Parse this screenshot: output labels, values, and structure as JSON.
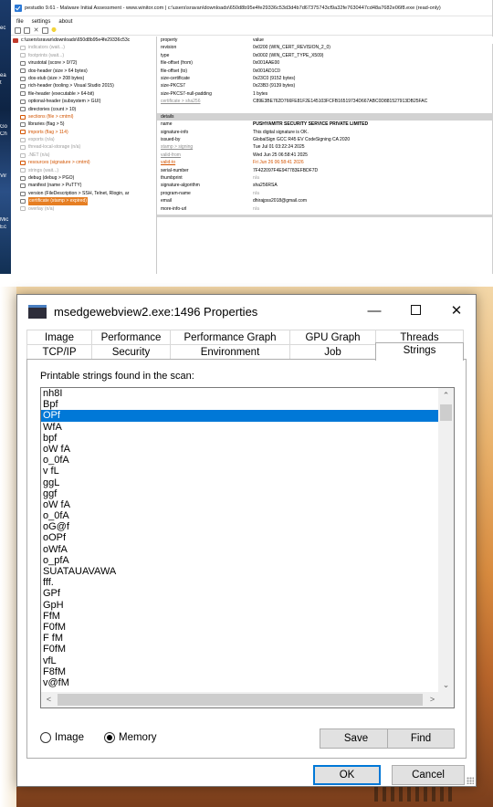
{
  "pestudio": {
    "title": "pestudio 9.61 - Malware Initial Assessment - www.winitor.com | c:\\users\\sravan\\downloads\\650d8b95e4fe29336c53d3d4b7d67375743cf9a32fe7630447cd48a7682e06f8.exe (read-only)",
    "menu": [
      "file",
      "settings",
      "about"
    ],
    "tree": [
      {
        "label": "c:\\users\\sravan\\downloads\\650d8b95e4fe29336c53c",
        "style": "root"
      },
      {
        "label": "indicators (wait...)",
        "style": "dim"
      },
      {
        "label": "footprints (wait...)",
        "style": "dim"
      },
      {
        "label": "virustotal (score > 0/72)",
        "style": "normal"
      },
      {
        "label": "dos-header (size > 64 bytes)",
        "style": "normal"
      },
      {
        "label": "dos-stub (size > 208 bytes)",
        "style": "normal"
      },
      {
        "label": "rich-header (tooling > Visual Studio 2015)",
        "style": "normal"
      },
      {
        "label": "file-header (executable > 64-bit)",
        "style": "normal"
      },
      {
        "label": "optional-header (subsystem > GUI)",
        "style": "normal"
      },
      {
        "label": "directories (count > 10)",
        "style": "normal"
      },
      {
        "label": "sections (file > cmtml)",
        "style": "alert"
      },
      {
        "label": "libraries (flag > 5)",
        "style": "normal"
      },
      {
        "label": "imports (flag > 114)",
        "style": "alert"
      },
      {
        "label": "exports (n/a)",
        "style": "dim"
      },
      {
        "label": "thread-local-storage (n/a)",
        "style": "dim"
      },
      {
        "label": ".NET (n/a)",
        "style": "dim"
      },
      {
        "label": "resources (signature > cmtml)",
        "style": "alert"
      },
      {
        "label": "strings (wait...)",
        "style": "dim"
      },
      {
        "label": "debug (debug > PGO)",
        "style": "normal"
      },
      {
        "label": "manifest (name > PuTTY)",
        "style": "normal"
      },
      {
        "label": "version (FileDescription > SSH, Telnet, Rlogin, ar",
        "style": "normal"
      },
      {
        "label": "certificate (stamp > expired)",
        "style": "selected"
      },
      {
        "label": "overlay (n/a)",
        "style": "dim"
      }
    ],
    "grid": {
      "header": {
        "property": "property",
        "value": "value"
      },
      "rows": [
        {
          "property": "revision",
          "value": "0x0200 (WIN_CERT_REVISION_2_0)",
          "style": "normal"
        },
        {
          "property": "type",
          "value": "0x0002 (WIN_CERT_TYPE_X509)",
          "style": "normal"
        },
        {
          "property": "file-offset (from)",
          "value": "0x001AAE00",
          "style": "normal"
        },
        {
          "property": "file-offset (to)",
          "value": "0x001AD1C0",
          "style": "normal"
        },
        {
          "property": "size-certificate",
          "value": "0x23C0 (9152 bytes)",
          "style": "normal"
        },
        {
          "property": "size-PKCS7",
          "value": "0x23B3 (9139 bytes)",
          "style": "normal"
        },
        {
          "property": "size-PKCS7-null-padding",
          "value": "1 bytes",
          "style": "normal"
        },
        {
          "property": "certificate > sha256",
          "value": "C89E3BE762D766FE81F2E145103FCFB16519734D667ABC0D881527913DB25FAC",
          "style": "link"
        }
      ],
      "section": "details",
      "details": [
        {
          "property": "name",
          "value": "PUSHYAMITR SECURITY SERVICE PRIVATE LIMITED",
          "style": "strong"
        },
        {
          "property": "signature-info",
          "value": "This digital signature is OK.",
          "style": "normal"
        },
        {
          "property": "issued-by",
          "value": "GlobalSign GCC R45 EV CodeSigning CA 2020",
          "style": "normal"
        },
        {
          "property": "stamp > signing",
          "value": "Tue Jul 01 03:22:24 2025",
          "style": "link"
        },
        {
          "property": "valid-from",
          "value": "Wed Jun 25 06:58:41 2025",
          "style": "link"
        },
        {
          "property": "valid-to",
          "value": "Fri Jun 26 06:58:41 2026",
          "style": "alert"
        },
        {
          "property": "serial-number",
          "value": "7F422097F4E947783EFBDF7D",
          "style": "normal"
        },
        {
          "property": "thumbprint",
          "value": "n/a",
          "style": "dim-value"
        },
        {
          "property": "signature-algorithm",
          "value": "sha256RSA",
          "style": "normal"
        },
        {
          "property": "program-name",
          "value": "n/a",
          "style": "dim-value"
        },
        {
          "property": "email",
          "value": "dhirajpss2018@gmail.com",
          "style": "normal"
        },
        {
          "property": "more-info-url",
          "value": "n/a",
          "style": "dim-value"
        }
      ]
    }
  },
  "dialog": {
    "title": "msedgewebview2.exe:1496 Properties",
    "controls": {
      "minimize": "—",
      "close": "✕"
    },
    "tabs_row1": [
      "Image",
      "Performance",
      "Performance Graph",
      "GPU Graph",
      "Threads"
    ],
    "tabs_row2": [
      "TCP/IP",
      "Security",
      "Environment",
      "Job",
      "Strings"
    ],
    "active_tab": "Strings",
    "caption": "Printable strings found in the scan:",
    "strings": [
      "nh8I",
      "Bpf",
      "OPf",
      "WfA",
      "bpf",
      "oW fA",
      "o_0fA",
      "v fL",
      "ggL",
      "ggf",
      "oW fA",
      "o_0fA",
      "oG@f",
      "oOPf",
      "oWfA",
      "o_pfA",
      "SUATAUAVAWA",
      "fff.",
      "GPf",
      "GpH",
      "FfM",
      "F0fM",
      "F fM",
      "F0fM",
      "vfL",
      "F8fM",
      "v@fM"
    ],
    "selected_index": 2,
    "scroll": {
      "up": "⌃",
      "down": "⌄",
      "left": "<",
      "right": ">"
    },
    "radio": {
      "image": "Image",
      "memory": "Memory",
      "selected": "memory"
    },
    "buttons": {
      "save": "Save",
      "find": "Find",
      "ok": "OK",
      "cancel": "Cancel"
    }
  },
  "desktop": {
    "side_labels": [
      "ec",
      "ea",
      "t",
      "Go",
      "Ch",
      "Vir",
      "Mic",
      "Ec"
    ]
  }
}
